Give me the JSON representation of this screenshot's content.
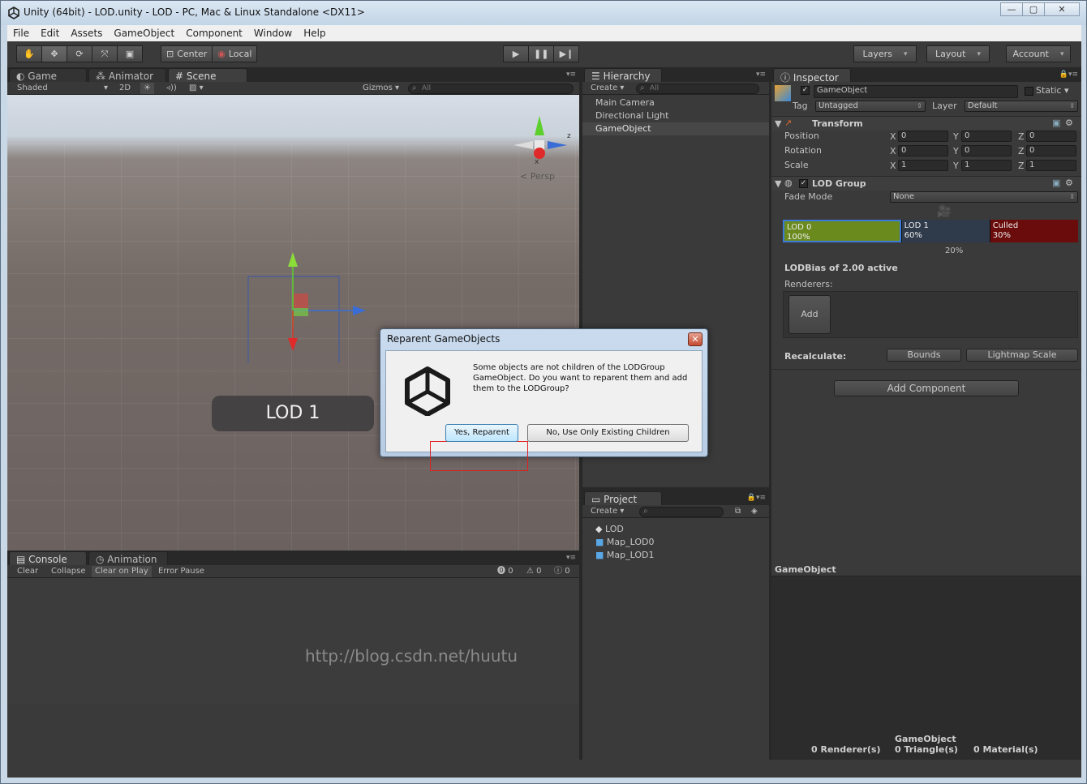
{
  "window": {
    "title": "Unity (64bit) - LOD.unity - LOD - PC, Mac & Linux Standalone <DX11>",
    "controls": [
      "—",
      "▢",
      "✕"
    ]
  },
  "menu": [
    "File",
    "Edit",
    "Assets",
    "GameObject",
    "Component",
    "Window",
    "Help"
  ],
  "toolbar": {
    "pivot": "Center",
    "space": "Local",
    "layers": "Layers",
    "layout": "Layout",
    "account": "Account"
  },
  "scene_panel": {
    "tabs": [
      "Game",
      "Animator",
      "Scene"
    ],
    "shading": "Shaded",
    "mode_2d": "2D",
    "gizmos": "Gizmos",
    "search_placeholder": "All",
    "axis_z": "z",
    "axis_x": "x",
    "projection": "Persp",
    "lod_label": "LOD 1"
  },
  "console_panel": {
    "tabs": [
      "Console",
      "Animation"
    ],
    "buttons": [
      "Clear",
      "Collapse",
      "Clear on Play",
      "Error Pause"
    ],
    "counts": [
      "0",
      "0",
      "0"
    ],
    "watermark": "http://blog.csdn.net/huutu"
  },
  "hierarchy": {
    "tab": "Hierarchy",
    "create": "Create",
    "search_placeholder": "All",
    "items": [
      "Main Camera",
      "Directional Light",
      "GameObject"
    ]
  },
  "project": {
    "tab": "Project",
    "create": "Create",
    "items": [
      "LOD",
      "Map_LOD0",
      "Map_LOD1"
    ]
  },
  "inspector": {
    "tab": "Inspector",
    "object_name": "GameObject",
    "static_label": "Static",
    "tag_label": "Tag",
    "tag_value": "Untagged",
    "layer_label": "Layer",
    "layer_value": "Default",
    "transform": {
      "title": "Transform",
      "rows": [
        {
          "label": "Position",
          "x": "0",
          "y": "0",
          "z": "0"
        },
        {
          "label": "Rotation",
          "x": "0",
          "y": "0",
          "z": "0"
        },
        {
          "label": "Scale",
          "x": "1",
          "y": "1",
          "z": "1"
        }
      ],
      "axis_labels": [
        "X",
        "Y",
        "Z"
      ]
    },
    "lod_group": {
      "title": "LOD Group",
      "fade_mode_label": "Fade Mode",
      "fade_mode_value": "None",
      "levels": [
        {
          "name": "LOD 0",
          "percent": "100%",
          "color": "#6b8a1e"
        },
        {
          "name": "LOD 1",
          "percent": "60%",
          "color": "#2f3a4a"
        },
        {
          "name": "Culled",
          "percent": "30%",
          "color": "#6a0c0c"
        }
      ],
      "camera_percent": "20%",
      "bias_text": "LODBias of 2.00 active",
      "renderers_label": "Renderers:",
      "add_label": "Add",
      "recalculate_label": "Recalculate:",
      "bounds_label": "Bounds",
      "lightmap_label": "Lightmap Scale"
    },
    "add_component": "Add Component"
  },
  "preview": {
    "title": "GameObject",
    "object": "GameObject",
    "renderers": "0 Renderer(s)",
    "triangles": "0 Triangle(s)",
    "materials": "0 Material(s)"
  },
  "dialog": {
    "title": "Reparent GameObjects",
    "message": "Some objects are not children of the LODGroup GameObject. Do you want to reparent them and add them to the LODGroup?",
    "yes": "Yes, Reparent",
    "no": "No, Use Only Existing Children",
    "close": "✕"
  }
}
